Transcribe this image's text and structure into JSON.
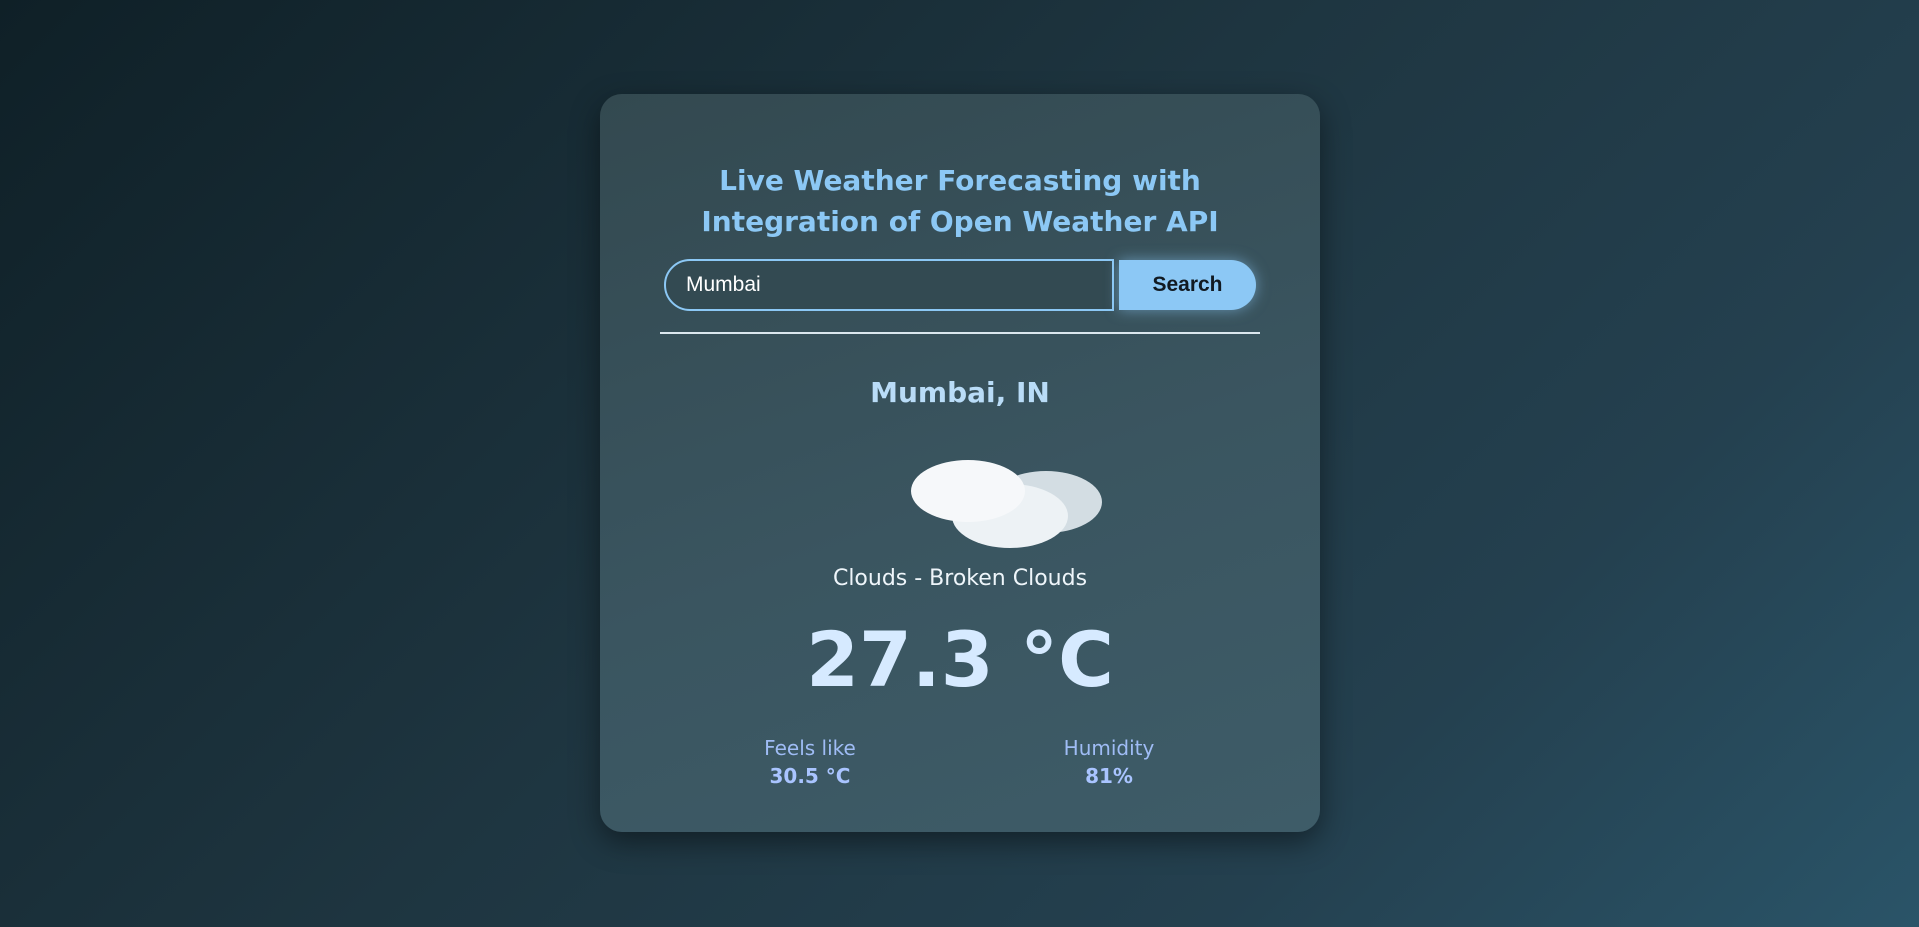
{
  "app": {
    "title": "Live Weather Forecasting with Integration of Open Weather API"
  },
  "search": {
    "value": "Mumbai",
    "button_label": "Search"
  },
  "weather": {
    "location": "Mumbai, IN",
    "icon": "broken-clouds-icon",
    "description": "Clouds - Broken Clouds",
    "temperature": "27.3 °C",
    "feels_like_label": "Feels like",
    "feels_like_value": "30.5 °C",
    "humidity_label": "Humidity",
    "humidity_value": "81%"
  },
  "colors": {
    "accent": "#8cc8f5",
    "card": "#3a5560",
    "temperature": "#d6eaff"
  }
}
